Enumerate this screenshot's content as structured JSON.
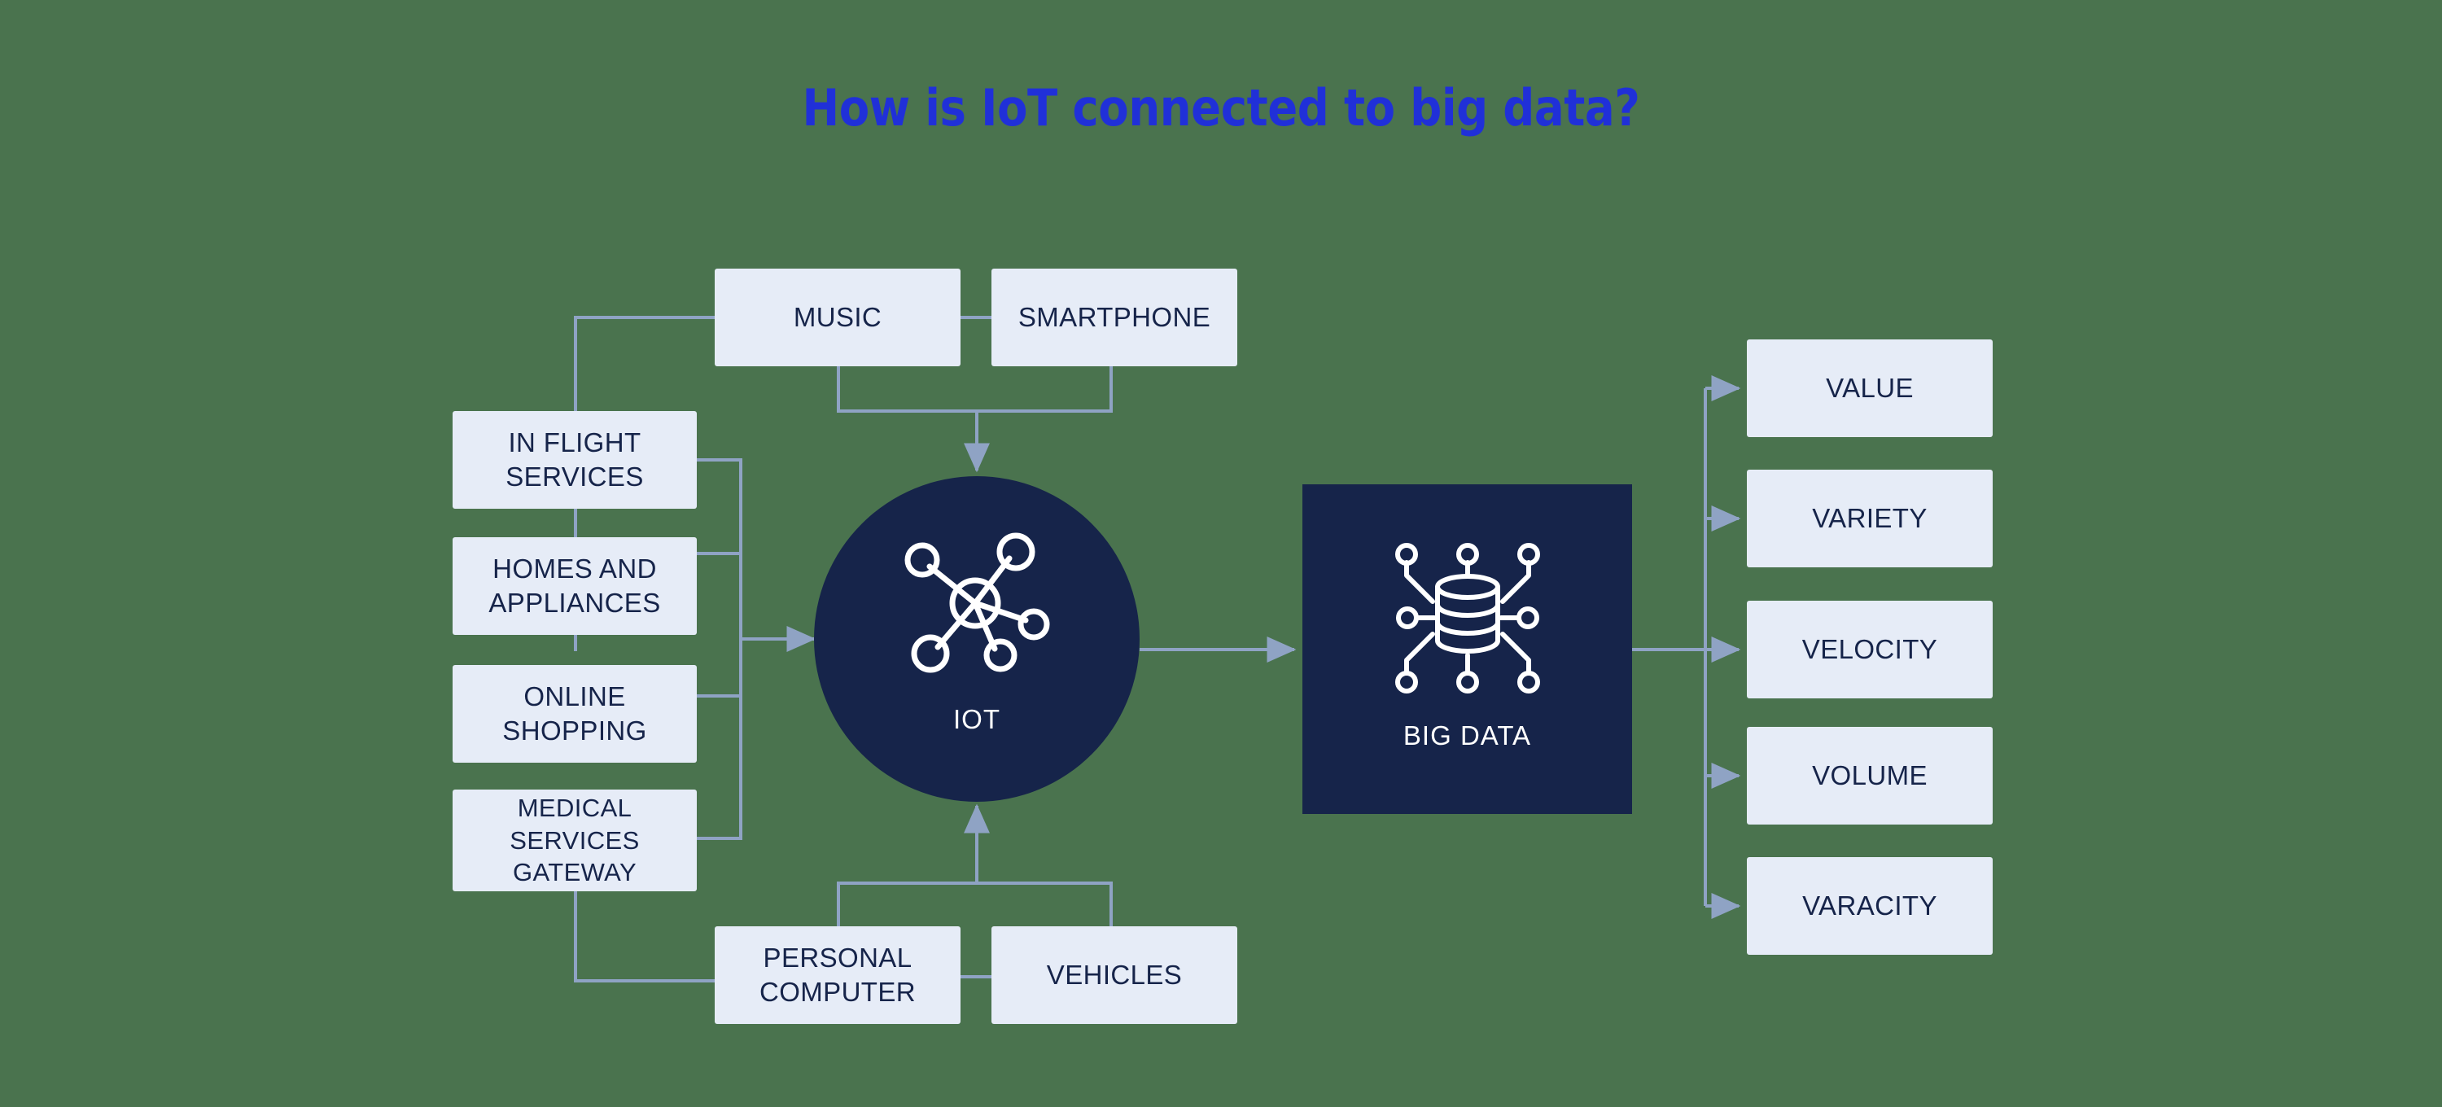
{
  "page": {
    "title": "How is IoT connected to big data?",
    "background_color": "#4a734e",
    "title_color": "#2030d8",
    "box_fill": "#e6ecf7",
    "box_text_color": "#16244a",
    "hub_fill": "#16244a",
    "connector_color": "#8fa3c4"
  },
  "hubs": {
    "iot": {
      "label": "IOT",
      "icon": "iot-network-icon",
      "shape": "circle"
    },
    "big_data": {
      "label": "BIG DATA",
      "icon": "database-network-icon",
      "shape": "square"
    }
  },
  "sources": {
    "top": [
      {
        "label": "MUSIC"
      },
      {
        "label": "SMARTPHONE"
      }
    ],
    "left": [
      {
        "label": "IN FLIGHT SERVICES"
      },
      {
        "label": "HOMES AND APPLIANCES"
      },
      {
        "label": "ONLINE SHOPPING"
      },
      {
        "label": "MEDICAL SERVICES GATEWAY"
      }
    ],
    "bottom": [
      {
        "label": "PERSONAL COMPUTER"
      },
      {
        "label": "VEHICLES"
      }
    ]
  },
  "outputs": [
    {
      "label": "VALUE"
    },
    {
      "label": "VARIETY"
    },
    {
      "label": "VELOCITY"
    },
    {
      "label": "VOLUME"
    },
    {
      "label": "VARACITY"
    }
  ]
}
